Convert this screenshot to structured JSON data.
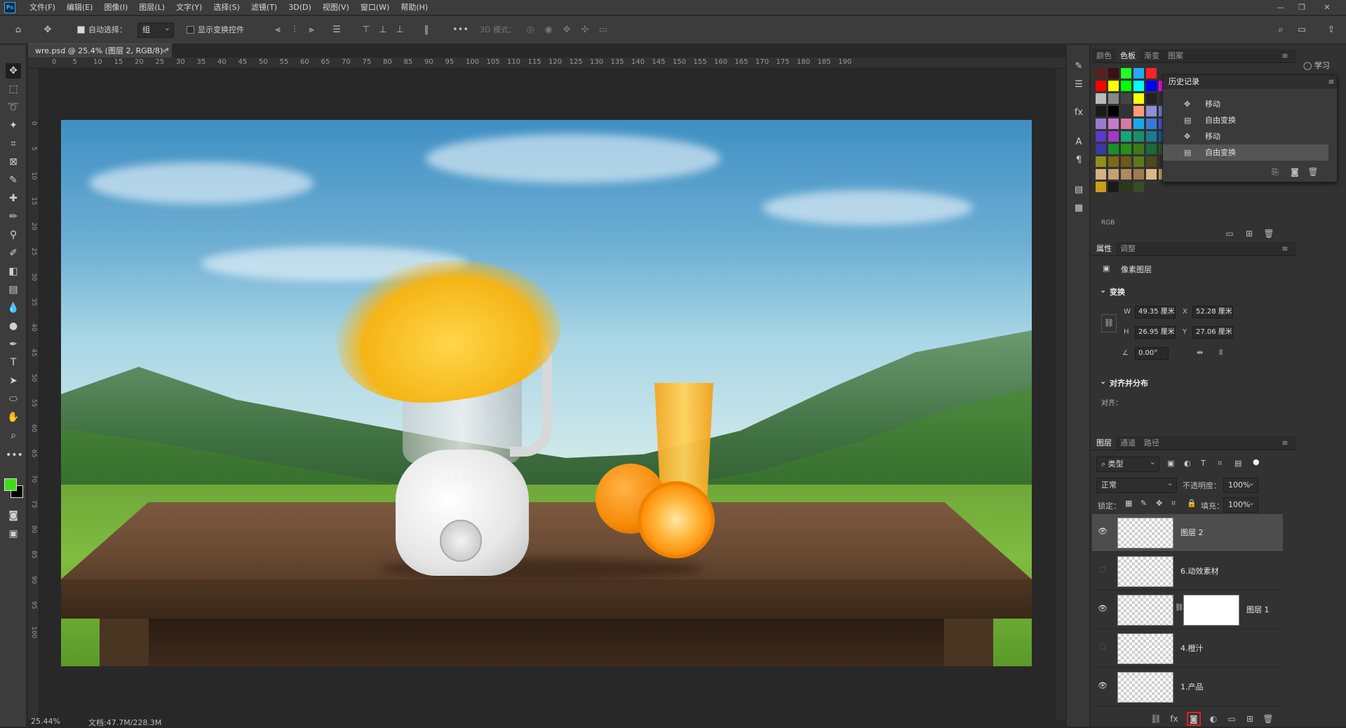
{
  "app": {
    "logo": "Ps"
  },
  "menubar": {
    "items": [
      "文件(F)",
      "编辑(E)",
      "图像(I)",
      "图层(L)",
      "文字(Y)",
      "选择(S)",
      "滤镜(T)",
      "3D(D)",
      "视图(V)",
      "窗口(W)",
      "帮助(H)"
    ],
    "win_min": "—",
    "win_restore": "❐",
    "win_close": "✕"
  },
  "options": {
    "auto_select_label": "自动选择：",
    "auto_select_value": "组",
    "show_transform_label": "显示变换控件",
    "mode_3d_label": "3D 模式："
  },
  "document": {
    "tab_title": "wre.psd @ 25.4% (图层 2, RGB/8) *",
    "zoom": "25.44%",
    "doc_size": "文档:47.7M/228.3M",
    "brand_text": "AVENT"
  },
  "ruler": {
    "top_ticks": [
      "0",
      "5",
      "10",
      "15",
      "20",
      "25",
      "30",
      "35",
      "40",
      "45",
      "50",
      "55",
      "60",
      "65",
      "70",
      "75",
      "80",
      "85",
      "90",
      "95",
      "100",
      "105",
      "110",
      "115",
      "120",
      "125",
      "130",
      "135",
      "140",
      "145",
      "150",
      "155",
      "160",
      "165",
      "170",
      "175",
      "180",
      "185",
      "190"
    ],
    "left_ticks": [
      "0",
      "5",
      "10",
      "15",
      "20",
      "25",
      "30",
      "35",
      "40",
      "45",
      "50",
      "55",
      "60",
      "65",
      "70",
      "75",
      "80",
      "85",
      "90",
      "95",
      "100"
    ]
  },
  "swatch_panel": {
    "tabs": [
      "颜色",
      "色板",
      "渐变",
      "图案"
    ],
    "active_tab": "色板",
    "group_label": "RGB",
    "colors": [
      "#5a1f1f",
      "#3a1010",
      "#22ff22",
      "#22aaff",
      "#ff2222",
      "#ff0000",
      "#ffff00",
      "#00ff00",
      "#00ffff",
      "#0000ff",
      "#ff00ff",
      "#bbbbbb",
      "#888888",
      "#444444",
      "#ffff00",
      "#222222",
      "#333333",
      "#1a1a1a",
      "#000000",
      "#333333",
      "#ff9a7a",
      "#8f8fd6",
      "#7a7ac8",
      "#9a7acc",
      "#c87acc",
      "#d67aa0",
      "#1aa9e6",
      "#3a7ad6",
      "#4a5ac8",
      "#5a3ac8",
      "#a03ac8",
      "#19a37a",
      "#1a8f6a",
      "#1a7a8f",
      "#1a5a9f",
      "#3a3aa0",
      "#1a8f2a",
      "#2a8f1a",
      "#3a7a1a",
      "#1a6a3a",
      "#2a5a2a",
      "#8f8f1a",
      "#7a6a1a",
      "#6a5a1a",
      "#5a7a1a",
      "#4a4a1a",
      "#d6b28a",
      "#c8a070",
      "#b08a60",
      "#a07a50",
      "#d8b888",
      "#c89a60",
      "#a87a40",
      "#8a5a2a",
      "#6a4a1a",
      "#ffffff",
      "#00ffd0",
      "#3a5a2a",
      "#5a5a1a",
      "#e6d83a",
      "#c8a01a",
      "#1a1a1a",
      "#2a3a1a",
      "#3a4a2a"
    ]
  },
  "history": {
    "title": "历史记录",
    "items": [
      "移动",
      "自由变换",
      "移动",
      "自由变换"
    ],
    "active_index": 3
  },
  "learn": {
    "label": "学习"
  },
  "properties": {
    "tabs": [
      "属性",
      "调整"
    ],
    "layer_type": "像素图层",
    "transform_title": "变换",
    "w_label": "W",
    "w": "49.35 厘米",
    "x_label": "X",
    "x": "52.28 厘米",
    "h_label": "H",
    "h": "26.95 厘米",
    "y_label": "Y",
    "y": "27.06 厘米",
    "angle": "0.00°",
    "align_title": "对齐并分布",
    "align_label": "对齐："
  },
  "layers_panel": {
    "tabs": [
      "图层",
      "通道",
      "路径"
    ],
    "filter_label": "类型",
    "blend_mode": "正常",
    "opacity_label": "不透明度：",
    "opacity": "100%",
    "lock_label": "锁定：",
    "fill_label": "填充：",
    "fill": "100%",
    "layers": [
      {
        "name": "图层 2",
        "visible": true,
        "active": true
      },
      {
        "name": "6.动效素材",
        "visible": false,
        "active": false
      },
      {
        "name": "图层 1",
        "visible": true,
        "active": false,
        "has_mask": true
      },
      {
        "name": "4.橙汁",
        "visible": false,
        "active": false
      },
      {
        "name": "1.产品",
        "visible": true,
        "active": false
      }
    ]
  },
  "colors": {
    "foreground": "#3fdc1c",
    "background": "#000000",
    "highlight": "#e02020"
  }
}
